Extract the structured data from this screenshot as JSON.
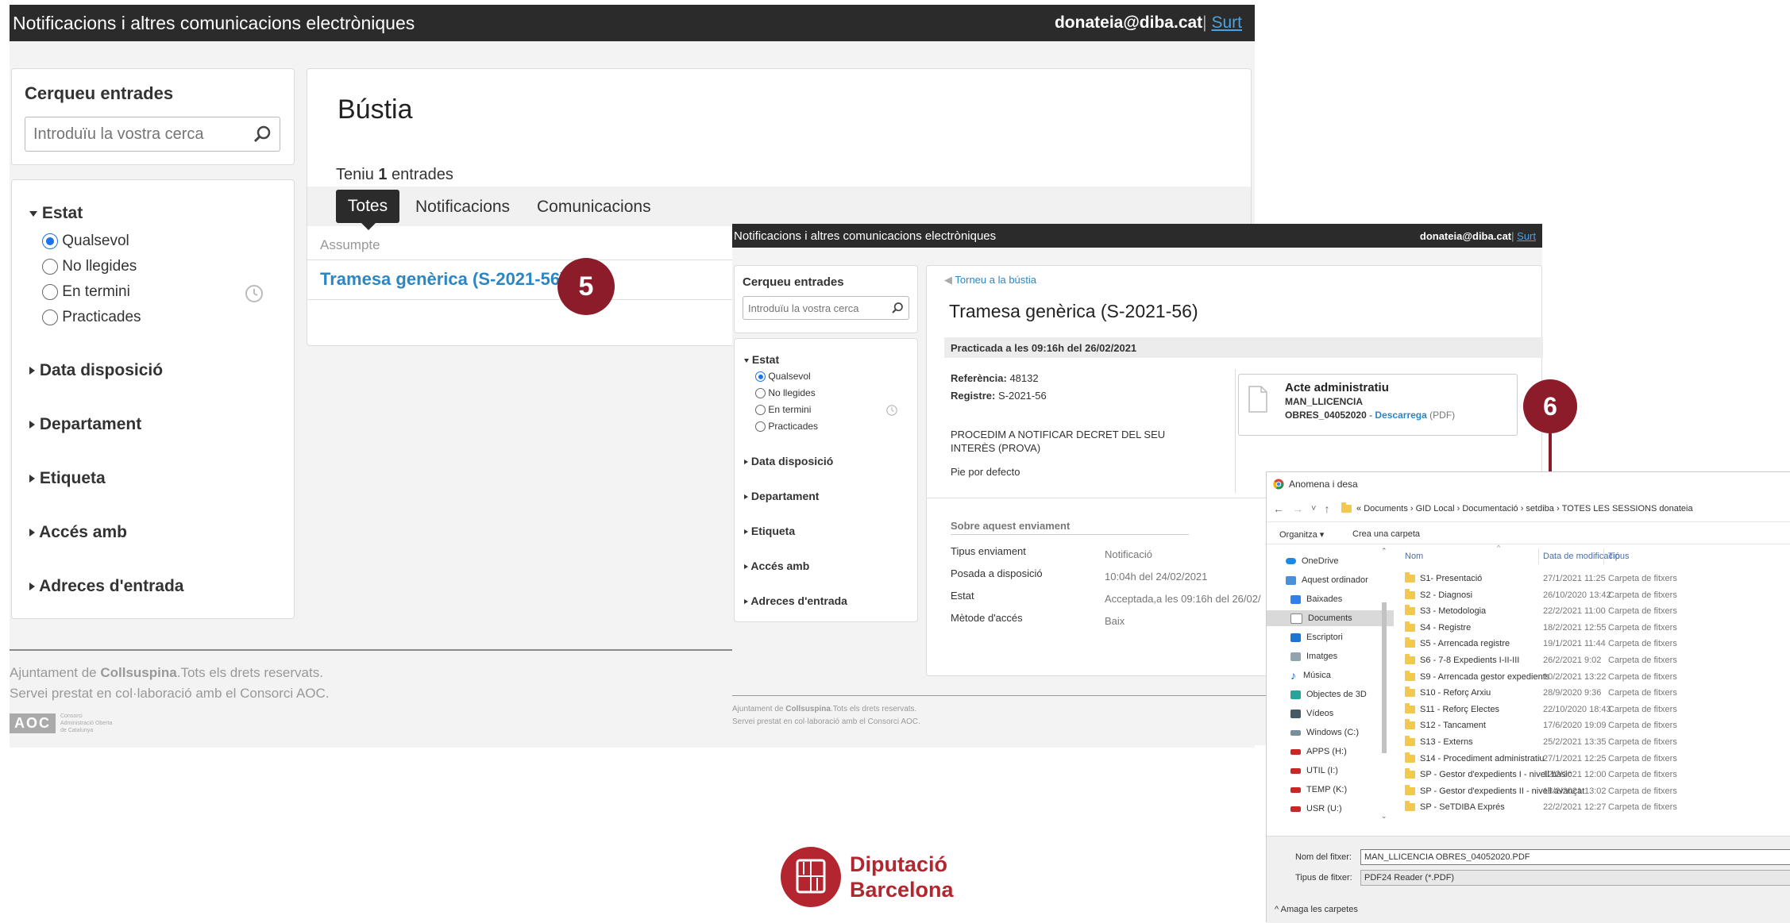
{
  "app": {
    "title": "Notificacions i altres comunicacions electròniques",
    "user": "donateia@diba.cat",
    "separator": "|",
    "logout": "Surt"
  },
  "search": {
    "title": "Cerqueu entrades",
    "placeholder": "Introduïu la vostra cerca"
  },
  "filters": {
    "estat_label": "Estat",
    "options": [
      "Qualsevol",
      "No llegides",
      "En termini",
      "Practicades"
    ],
    "selected": "Qualsevol",
    "sections": [
      "Data disposició",
      "Departament",
      "Etiqueta",
      "Accés amb",
      "Adreces d'entrada"
    ]
  },
  "bustia": {
    "title": "Bústia",
    "count_prefix": "Teniu ",
    "count": "1",
    "count_suffix": " entrades",
    "tabs": [
      "Totes",
      "Notificacions",
      "Comunicacions"
    ],
    "active_tab": "Totes",
    "column_header": "Assumpte",
    "entry": "Tramesa genèrica (S-2021-56)"
  },
  "footer": {
    "prefix": "Ajuntament de ",
    "org": "Collsuspina",
    "rights": ".Tots els drets reservats.",
    "line2": "Servei prestat en col·laboració amb el Consorci AOC.",
    "logo_text": "AOC",
    "logo_sub": [
      "Consorci",
      "Administració Oberta",
      "de Catalunya"
    ]
  },
  "detail": {
    "back": "Torneu a la bústia",
    "title": "Tramesa genèrica (S-2021-56)",
    "status_bar": "Practicada a les 09:16h del 26/02/2021",
    "ref_label": "Referència:",
    "ref_value": "48132",
    "reg_label": "Registre:",
    "reg_value": "S-2021-56",
    "body": "PROCEDIM A NOTIFICAR DECRET DEL SEU INTERÈS (PROVA)",
    "footer_text": "Pie por defecto",
    "attachment": {
      "title": "Acte administratiu",
      "name_line1": "MAN_LLICENCIA",
      "name_line2": "OBRES_04052020",
      "dash": " - ",
      "download": "Descarrega",
      "format": " (PDF)"
    },
    "about": {
      "title": "Sobre aquest enviament",
      "rows": [
        {
          "label": "Tipus enviament",
          "value": "Notificació"
        },
        {
          "label": "Posada a disposició",
          "value": "10:04h del 24/02/2021"
        },
        {
          "label": "Estat",
          "value": "Acceptada,a les 09:16h del 26/02/"
        },
        {
          "label": "Mètode d'accés",
          "value": "Baix"
        }
      ]
    }
  },
  "dialog": {
    "title": "Anomena i desa",
    "nav": [
      "←",
      "→",
      "˅",
      "↑"
    ],
    "breadcrumb": [
      "Documents",
      "GID Local",
      "Documentació",
      "setdiba",
      "TOTES LES SESSIONS donateia"
    ],
    "breadcrumb_prefix": "«",
    "organize": "Organitza ▾",
    "new_folder": "Crea una carpeta",
    "sidebar": [
      "OneDrive",
      "Aquest ordinador",
      "Baixades",
      "Documents",
      "Escriptori",
      "Imatges",
      "Música",
      "Objectes de 3D",
      "Vídeos",
      "Windows (C:)",
      "APPS (H:)",
      "UTIL (I:)",
      "TEMP (K:)",
      "USR (U:)"
    ],
    "selected_sidebar": "Documents",
    "columns": [
      "Nom",
      "Data de modificació",
      "Tipus"
    ],
    "files": [
      {
        "name": "S1- Presentació",
        "date": "27/1/2021 11:25",
        "type": "Carpeta de fitxers"
      },
      {
        "name": "S2 - Diagnosi",
        "date": "26/10/2020 13:42",
        "type": "Carpeta de fitxers"
      },
      {
        "name": "S3 - Metodologia",
        "date": "22/2/2021 11:00",
        "type": "Carpeta de fitxers"
      },
      {
        "name": "S4 - Registre",
        "date": "18/2/2021 12:55",
        "type": "Carpeta de fitxers"
      },
      {
        "name": "S5 - Arrencada registre",
        "date": "19/1/2021 11:44",
        "type": "Carpeta de fitxers"
      },
      {
        "name": "S6 - 7-8 Expedients I-II-III",
        "date": "26/2/2021 9:02",
        "type": "Carpeta de fitxers"
      },
      {
        "name": "S9 - Arrencada gestor expedients",
        "date": "10/2/2021 13:22",
        "type": "Carpeta de fitxers"
      },
      {
        "name": "S10 - Reforç Arxiu",
        "date": "28/9/2020 9:36",
        "type": "Carpeta de fitxers"
      },
      {
        "name": "S11 - Reforç Electes",
        "date": "22/10/2020 18:43",
        "type": "Carpeta de fitxers"
      },
      {
        "name": "S12 - Tancament",
        "date": "17/6/2020 19:09",
        "type": "Carpeta de fitxers"
      },
      {
        "name": "S13 - Externs",
        "date": "25/2/2021 13:35",
        "type": "Carpeta de fitxers"
      },
      {
        "name": "S14 - Procediment administratiu",
        "date": "27/1/2021 12:25",
        "type": "Carpeta de fitxers"
      },
      {
        "name": "SP - Gestor d'expedients I - nivell bàsic",
        "date": "12/2/2021 12:00",
        "type": "Carpeta de fitxers"
      },
      {
        "name": "SP - Gestor d'expedients II - nivell avançat",
        "date": "18/2/2021 13:02",
        "type": "Carpeta de fitxers"
      },
      {
        "name": "SP - SeTDIBA Exprés",
        "date": "22/2/2021 12:27",
        "type": "Carpeta de fitxers"
      }
    ],
    "filename_label": "Nom del fitxer:",
    "filename": "MAN_LLICENCIA OBRES_04052020.PDF",
    "filetype_label": "Tipus de fitxer:",
    "filetype": "PDF24 Reader (*.PDF)",
    "hide_folders": "Amaga les carpetes"
  },
  "badges": {
    "five": "5",
    "six": "6"
  },
  "branding": {
    "line1": "Diputació",
    "line2": "Barcelona"
  },
  "colors": {
    "badge": "#8c1c2a",
    "link": "#2e86c1",
    "topbar": "#2b2b2b",
    "radio": "#1a73e8"
  }
}
